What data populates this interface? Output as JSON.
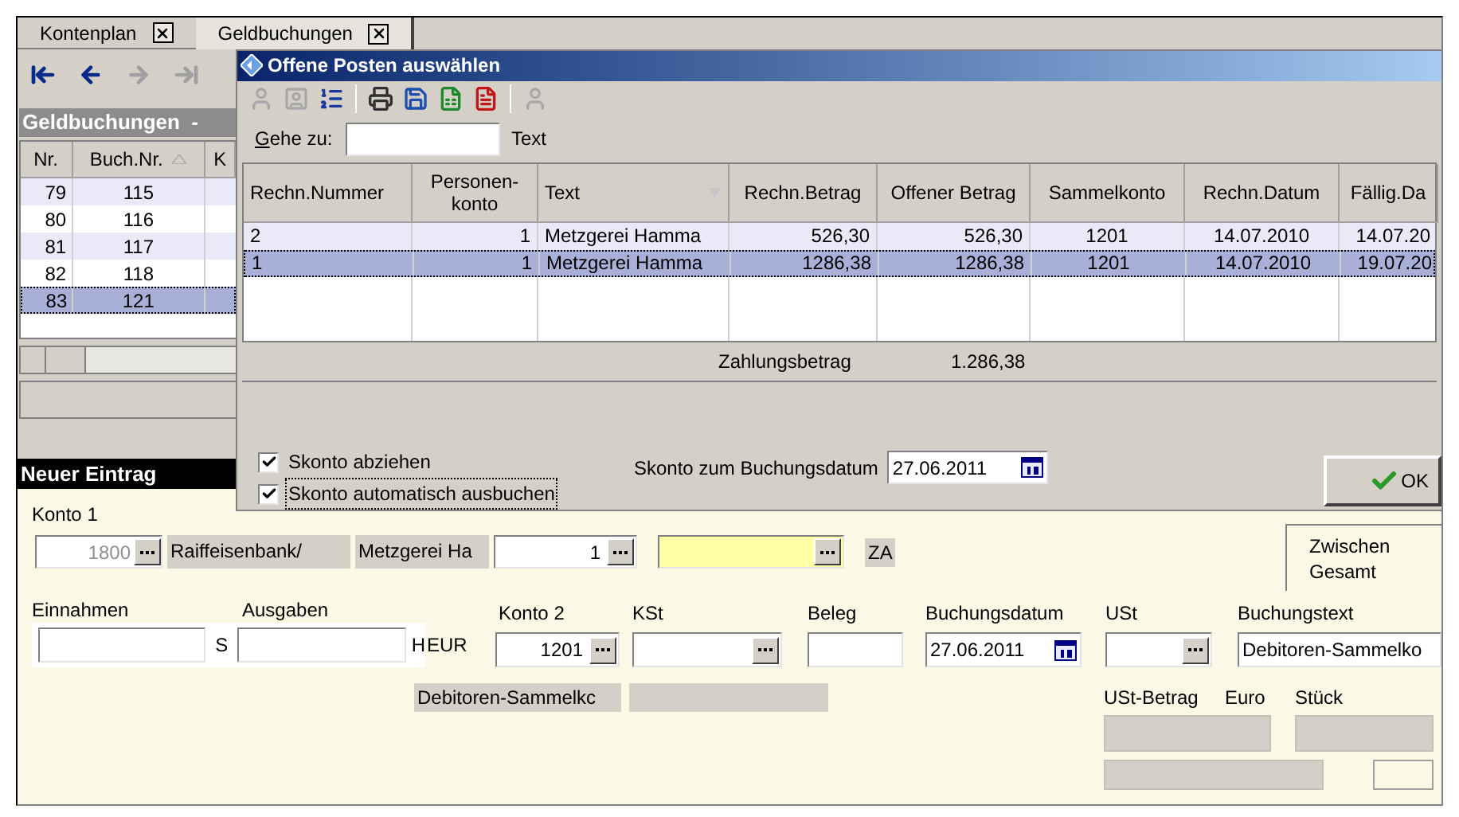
{
  "tabs": [
    {
      "label": "Kontenplan",
      "selected": false
    },
    {
      "label": "Geldbuchungen",
      "selected": true
    }
  ],
  "nav_buttons": [
    {
      "kind": "first",
      "disabled": false
    },
    {
      "kind": "previous",
      "disabled": false
    },
    {
      "kind": "next",
      "disabled": true
    },
    {
      "kind": "last",
      "disabled": true
    }
  ],
  "list_panel": {
    "title": "Geldbuchungen  -",
    "columns": [
      {
        "label": "Nr."
      },
      {
        "label": "Buch.Nr.",
        "sorted": true,
        "descending": false
      },
      {
        "label": "K"
      }
    ],
    "rows": [
      {
        "cells": [
          "79",
          "115"
        ],
        "selected": false
      },
      {
        "cells": [
          "80",
          "116"
        ],
        "selected": false
      },
      {
        "cells": [
          "81",
          "117"
        ],
        "selected": false
      },
      {
        "cells": [
          "82",
          "118"
        ],
        "selected": false
      },
      {
        "cells": [
          "83",
          "121"
        ],
        "selected": true
      }
    ]
  },
  "entry_form": {
    "title": "Neuer Eintrag",
    "konto1": {
      "label": "Konto 1",
      "value": "1800",
      "disabled": true
    },
    "account_name": "Raiffeisenbank/",
    "partner_name": "Metzgerei Ha",
    "partner_no": "1",
    "za": "ZA",
    "totals": [
      "Zwischen",
      "Gesamt"
    ],
    "einnahmen": {
      "label": "Einnahmen",
      "suffix": "S"
    },
    "ausgaben": {
      "label": "Ausgaben",
      "suffix": "H"
    },
    "currency": "EUR",
    "konto2": {
      "label": "Konto 2",
      "value": "1201"
    },
    "kst": {
      "label": "KSt"
    },
    "beleg": {
      "label": "Beleg"
    },
    "buchungsdatum": {
      "label": "Buchungsdatum",
      "value": "27.06.2011"
    },
    "ust": {
      "label": "USt"
    },
    "buchungstext": {
      "label": "Buchungstext",
      "value": "Debitoren-Sammelko"
    },
    "konto2_name": "Debitoren-Sammelkc",
    "ust_betrag_label": "USt-Betrag",
    "euro_label": "Euro",
    "stueck_label": "Stück"
  },
  "dialog": {
    "title": "Offene Posten auswählen",
    "toolbar": [
      {
        "kind": "person",
        "disabled": true
      },
      {
        "kind": "person_card",
        "disabled": true
      },
      {
        "kind": "columns",
        "disabled": false
      },
      {
        "kind": "separator"
      },
      {
        "kind": "print",
        "disabled": false
      },
      {
        "kind": "save",
        "disabled": false
      },
      {
        "kind": "excel",
        "disabled": false
      },
      {
        "kind": "pdf",
        "disabled": false
      },
      {
        "kind": "separator"
      },
      {
        "kind": "person",
        "disabled": true
      }
    ],
    "goto": {
      "label": "Gehe zu:",
      "column": "Text"
    },
    "columns": [
      {
        "label": "Rechn.Nummer"
      },
      {
        "label": "Personen-konto"
      },
      {
        "label": "Text",
        "sorted": true,
        "descending": true
      },
      {
        "label": "Rechn.Betrag"
      },
      {
        "label": "Offener Betrag"
      },
      {
        "label": "Sammelkonto"
      },
      {
        "label": "Rechn.Datum"
      },
      {
        "label": "Fällig.Da"
      }
    ],
    "rows": [
      {
        "cells": [
          "2",
          "1",
          "Metzgerei Hamma",
          "526,30",
          "526,30",
          "1201",
          "14.07.2010",
          "14.07.20"
        ],
        "selected": false
      },
      {
        "cells": [
          "1",
          "1",
          "Metzgerei Hamma",
          "1286,38",
          "1286,38",
          "1201",
          "14.07.2010",
          "19.07.20"
        ],
        "selected": true
      }
    ],
    "payment": {
      "label": "Zahlungsbetrag",
      "value": "1.286,38"
    },
    "checkboxes": [
      {
        "label": "Skonto abziehen",
        "checked": true,
        "focused": false
      },
      {
        "label": "Skonto automatisch ausbuchen",
        "checked": true,
        "focused": true
      }
    ],
    "skonto_date": {
      "label": "Skonto zum Buchungsdatum",
      "value": "27.06.2011"
    },
    "ok_button": "OK"
  }
}
